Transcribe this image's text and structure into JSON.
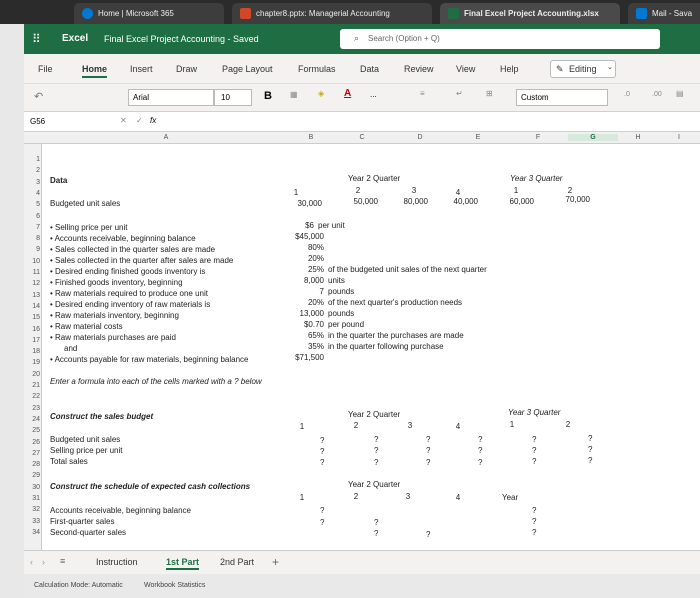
{
  "browser": {
    "tabs": [
      {
        "label": "Home | Microsoft 365"
      },
      {
        "label": "chapter8.pptx: Managerial Accounting"
      },
      {
        "label": "Final Excel Project Accounting.xlsx"
      },
      {
        "label": "Mail - Sava"
      }
    ]
  },
  "titlebar": {
    "app_name": "Excel",
    "doc_title": "Final Excel Project Accounting - Saved",
    "search_placeholder": "Search (Option + Q)"
  },
  "menu": {
    "items": [
      "File",
      "Home",
      "Insert",
      "Draw",
      "Page Layout",
      "Formulas",
      "Data",
      "Review",
      "View",
      "Help"
    ],
    "editing_label": "Editing"
  },
  "toolbar": {
    "font_name": "Arial",
    "font_size": "10",
    "bold": "B",
    "format": "Custom",
    "more": "..."
  },
  "formula_bar": {
    "name_box": "G56",
    "fx": "fx"
  },
  "columns": [
    "A",
    "B",
    "C",
    "D",
    "E",
    "F",
    "G",
    "H",
    "I"
  ],
  "rows": [
    "1",
    "2",
    "3",
    "4",
    "5",
    "6",
    "7",
    "8",
    "9",
    "10",
    "11",
    "12",
    "13",
    "14",
    "15",
    "16",
    "17",
    "18",
    "19",
    "20",
    "21",
    "22",
    "23",
    "24",
    "25",
    "26",
    "27",
    "28",
    "29",
    "30",
    "31",
    "32",
    "33",
    "34"
  ],
  "cells": {
    "r3_data": "Data",
    "r3_y2q": "Year 2 Quarter",
    "r3_y3q": "Year 3 Quarter",
    "r4_q1": "1",
    "r4_q2": "2",
    "r4_q3": "3",
    "r4_q4": "4",
    "r4_y3q1": "1",
    "r4_y3q2": "2",
    "r5_label": "Budgeted unit sales",
    "r5_b": "30,000",
    "r5_c": "50,000",
    "r5_d": "80,000",
    "r5_e": "40,000",
    "r5_f": "60,000",
    "r5_g": "70,000",
    "r7_label": "• Selling price per unit",
    "r7_val": "$6",
    "r7_note": "per unit",
    "r8_label": "• Accounts receivable, beginning balance",
    "r8_val": "$45,000",
    "r9_label": "• Sales collected in the quarter sales are made",
    "r9_val": "80%",
    "r10_label": "• Sales collected in the quarter after sales are made",
    "r10_val": "20%",
    "r11_label": "• Desired ending finished goods inventory is",
    "r11_val": "25%",
    "r11_note": "of the budgeted unit sales of the next quarter",
    "r12_label": "• Finished goods inventory, beginning",
    "r12_val": "8,000",
    "r12_note": "units",
    "r13_label": "• Raw materials required to produce one unit",
    "r13_val": "7",
    "r13_note": "pounds",
    "r14_label": "• Desired ending inventory of raw materials is",
    "r14_val": "20%",
    "r14_note": "of the next quarter's production needs",
    "r15_label": "• Raw materials inventory, beginning",
    "r15_val": "13,000",
    "r15_note": "pounds",
    "r16_label": "• Raw material costs",
    "r16_val": "$0.70",
    "r16_note": "per pound",
    "r17_label": "• Raw materials purchases are paid",
    "r17_val": "65%",
    "r17_note": "in the quarter the purchases are made",
    "r18_label": "and",
    "r18_val": "35%",
    "r18_note": "in the quarter following purchase",
    "r19_label": "• Accounts payable for raw materials, beginning balance",
    "r19_val": "$71,500",
    "r21_label": "Enter a formula into each of the cells marked with a ? below",
    "r24_label": "Construct the sales budget",
    "r24_y2q": "Year 2 Quarter",
    "r24_y3q": "Year 3 Quarter",
    "r25_q1": "1",
    "r25_q2": "2",
    "r25_q3": "3",
    "r25_q4": "4",
    "r25_y3q1": "1",
    "r25_y3q2": "2",
    "r26_label": "Budgeted unit sales",
    "r27_label": "Selling price per unit",
    "r28_label": "Total sales",
    "q": "?",
    "r30_label": "Construct the schedule of expected cash collections",
    "r30_y2q": "Year 2 Quarter",
    "r31_q1": "1",
    "r31_q2": "2",
    "r31_q3": "3",
    "r31_q4": "4",
    "r31_year": "Year",
    "r32_label": "Accounts receivable, beginning balance",
    "r33_label": "First-quarter sales",
    "r34_label": "Second-quarter sales"
  },
  "sheets": {
    "tabs": [
      "Instruction",
      "1st Part",
      "2nd Part"
    ],
    "active": "1st Part",
    "add": "+"
  },
  "status": {
    "calc_mode": "Calculation Mode: Automatic",
    "stats": "Workbook Statistics"
  },
  "colors": {
    "excel_green": "#1f6e43",
    "header_gray": "#f0f0f0"
  }
}
